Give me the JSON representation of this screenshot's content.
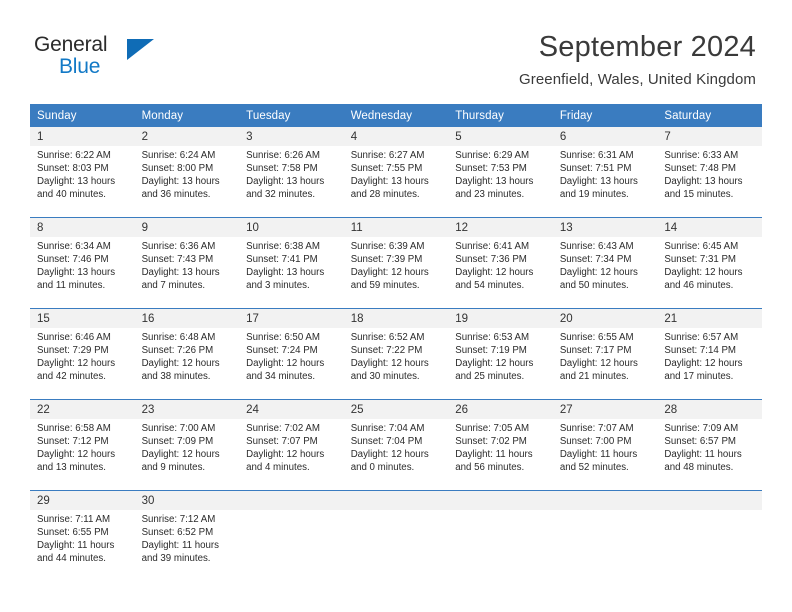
{
  "brand": {
    "name_part1": "General",
    "name_part2": "Blue",
    "accent_color": "#0f6cb6"
  },
  "header": {
    "title": "September 2024",
    "location": "Greenfield, Wales, United Kingdom",
    "header_bg": "#3a7cc0"
  },
  "calendar": {
    "weekday_headers": [
      "Sunday",
      "Monday",
      "Tuesday",
      "Wednesday",
      "Thursday",
      "Friday",
      "Saturday"
    ],
    "weeks": [
      [
        {
          "day": "1",
          "sunrise": "Sunrise: 6:22 AM",
          "sunset": "Sunset: 8:03 PM",
          "daylight1": "Daylight: 13 hours",
          "daylight2": "and 40 minutes."
        },
        {
          "day": "2",
          "sunrise": "Sunrise: 6:24 AM",
          "sunset": "Sunset: 8:00 PM",
          "daylight1": "Daylight: 13 hours",
          "daylight2": "and 36 minutes."
        },
        {
          "day": "3",
          "sunrise": "Sunrise: 6:26 AM",
          "sunset": "Sunset: 7:58 PM",
          "daylight1": "Daylight: 13 hours",
          "daylight2": "and 32 minutes."
        },
        {
          "day": "4",
          "sunrise": "Sunrise: 6:27 AM",
          "sunset": "Sunset: 7:55 PM",
          "daylight1": "Daylight: 13 hours",
          "daylight2": "and 28 minutes."
        },
        {
          "day": "5",
          "sunrise": "Sunrise: 6:29 AM",
          "sunset": "Sunset: 7:53 PM",
          "daylight1": "Daylight: 13 hours",
          "daylight2": "and 23 minutes."
        },
        {
          "day": "6",
          "sunrise": "Sunrise: 6:31 AM",
          "sunset": "Sunset: 7:51 PM",
          "daylight1": "Daylight: 13 hours",
          "daylight2": "and 19 minutes."
        },
        {
          "day": "7",
          "sunrise": "Sunrise: 6:33 AM",
          "sunset": "Sunset: 7:48 PM",
          "daylight1": "Daylight: 13 hours",
          "daylight2": "and 15 minutes."
        }
      ],
      [
        {
          "day": "8",
          "sunrise": "Sunrise: 6:34 AM",
          "sunset": "Sunset: 7:46 PM",
          "daylight1": "Daylight: 13 hours",
          "daylight2": "and 11 minutes."
        },
        {
          "day": "9",
          "sunrise": "Sunrise: 6:36 AM",
          "sunset": "Sunset: 7:43 PM",
          "daylight1": "Daylight: 13 hours",
          "daylight2": "and 7 minutes."
        },
        {
          "day": "10",
          "sunrise": "Sunrise: 6:38 AM",
          "sunset": "Sunset: 7:41 PM",
          "daylight1": "Daylight: 13 hours",
          "daylight2": "and 3 minutes."
        },
        {
          "day": "11",
          "sunrise": "Sunrise: 6:39 AM",
          "sunset": "Sunset: 7:39 PM",
          "daylight1": "Daylight: 12 hours",
          "daylight2": "and 59 minutes."
        },
        {
          "day": "12",
          "sunrise": "Sunrise: 6:41 AM",
          "sunset": "Sunset: 7:36 PM",
          "daylight1": "Daylight: 12 hours",
          "daylight2": "and 54 minutes."
        },
        {
          "day": "13",
          "sunrise": "Sunrise: 6:43 AM",
          "sunset": "Sunset: 7:34 PM",
          "daylight1": "Daylight: 12 hours",
          "daylight2": "and 50 minutes."
        },
        {
          "day": "14",
          "sunrise": "Sunrise: 6:45 AM",
          "sunset": "Sunset: 7:31 PM",
          "daylight1": "Daylight: 12 hours",
          "daylight2": "and 46 minutes."
        }
      ],
      [
        {
          "day": "15",
          "sunrise": "Sunrise: 6:46 AM",
          "sunset": "Sunset: 7:29 PM",
          "daylight1": "Daylight: 12 hours",
          "daylight2": "and 42 minutes."
        },
        {
          "day": "16",
          "sunrise": "Sunrise: 6:48 AM",
          "sunset": "Sunset: 7:26 PM",
          "daylight1": "Daylight: 12 hours",
          "daylight2": "and 38 minutes."
        },
        {
          "day": "17",
          "sunrise": "Sunrise: 6:50 AM",
          "sunset": "Sunset: 7:24 PM",
          "daylight1": "Daylight: 12 hours",
          "daylight2": "and 34 minutes."
        },
        {
          "day": "18",
          "sunrise": "Sunrise: 6:52 AM",
          "sunset": "Sunset: 7:22 PM",
          "daylight1": "Daylight: 12 hours",
          "daylight2": "and 30 minutes."
        },
        {
          "day": "19",
          "sunrise": "Sunrise: 6:53 AM",
          "sunset": "Sunset: 7:19 PM",
          "daylight1": "Daylight: 12 hours",
          "daylight2": "and 25 minutes."
        },
        {
          "day": "20",
          "sunrise": "Sunrise: 6:55 AM",
          "sunset": "Sunset: 7:17 PM",
          "daylight1": "Daylight: 12 hours",
          "daylight2": "and 21 minutes."
        },
        {
          "day": "21",
          "sunrise": "Sunrise: 6:57 AM",
          "sunset": "Sunset: 7:14 PM",
          "daylight1": "Daylight: 12 hours",
          "daylight2": "and 17 minutes."
        }
      ],
      [
        {
          "day": "22",
          "sunrise": "Sunrise: 6:58 AM",
          "sunset": "Sunset: 7:12 PM",
          "daylight1": "Daylight: 12 hours",
          "daylight2": "and 13 minutes."
        },
        {
          "day": "23",
          "sunrise": "Sunrise: 7:00 AM",
          "sunset": "Sunset: 7:09 PM",
          "daylight1": "Daylight: 12 hours",
          "daylight2": "and 9 minutes."
        },
        {
          "day": "24",
          "sunrise": "Sunrise: 7:02 AM",
          "sunset": "Sunset: 7:07 PM",
          "daylight1": "Daylight: 12 hours",
          "daylight2": "and 4 minutes."
        },
        {
          "day": "25",
          "sunrise": "Sunrise: 7:04 AM",
          "sunset": "Sunset: 7:04 PM",
          "daylight1": "Daylight: 12 hours",
          "daylight2": "and 0 minutes."
        },
        {
          "day": "26",
          "sunrise": "Sunrise: 7:05 AM",
          "sunset": "Sunset: 7:02 PM",
          "daylight1": "Daylight: 11 hours",
          "daylight2": "and 56 minutes."
        },
        {
          "day": "27",
          "sunrise": "Sunrise: 7:07 AM",
          "sunset": "Sunset: 7:00 PM",
          "daylight1": "Daylight: 11 hours",
          "daylight2": "and 52 minutes."
        },
        {
          "day": "28",
          "sunrise": "Sunrise: 7:09 AM",
          "sunset": "Sunset: 6:57 PM",
          "daylight1": "Daylight: 11 hours",
          "daylight2": "and 48 minutes."
        }
      ],
      [
        {
          "day": "29",
          "sunrise": "Sunrise: 7:11 AM",
          "sunset": "Sunset: 6:55 PM",
          "daylight1": "Daylight: 11 hours",
          "daylight2": "and 44 minutes."
        },
        {
          "day": "30",
          "sunrise": "Sunrise: 7:12 AM",
          "sunset": "Sunset: 6:52 PM",
          "daylight1": "Daylight: 11 hours",
          "daylight2": "and 39 minutes."
        },
        {
          "day": "",
          "sunrise": "",
          "sunset": "",
          "daylight1": "",
          "daylight2": ""
        },
        {
          "day": "",
          "sunrise": "",
          "sunset": "",
          "daylight1": "",
          "daylight2": ""
        },
        {
          "day": "",
          "sunrise": "",
          "sunset": "",
          "daylight1": "",
          "daylight2": ""
        },
        {
          "day": "",
          "sunrise": "",
          "sunset": "",
          "daylight1": "",
          "daylight2": ""
        },
        {
          "day": "",
          "sunrise": "",
          "sunset": "",
          "daylight1": "",
          "daylight2": ""
        }
      ]
    ]
  }
}
